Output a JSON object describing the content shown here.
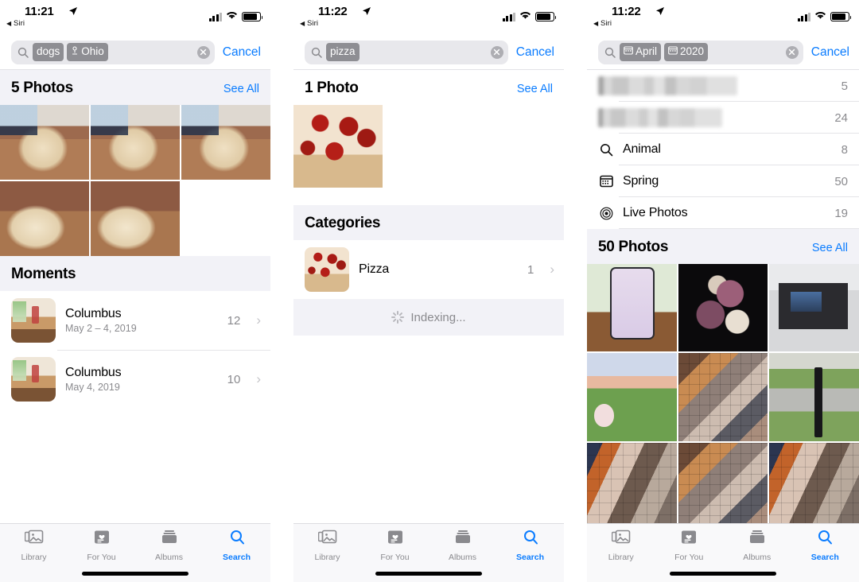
{
  "panels": [
    {
      "id": "panel-dogs-ohio",
      "status": {
        "time": "11:21",
        "back_label": "Siri",
        "location_icon": "location-arrow-icon",
        "signal_icon": "cellular-signal-icon",
        "wifi_icon": "wifi-icon",
        "battery_icon": "battery-icon"
      },
      "search": {
        "icon": "search-icon",
        "tokens": [
          {
            "label": "dogs",
            "icon": null
          },
          {
            "label": "Ohio",
            "icon": "location-pin-icon"
          }
        ],
        "clear_icon": "clear-x-icon",
        "cancel_label": "Cancel"
      },
      "photos_section": {
        "title": "5 Photos",
        "see_all": "See All",
        "count": 5
      },
      "moments": {
        "title": "Moments",
        "rows": [
          {
            "title": "Columbus",
            "subtitle": "May 2 – 4, 2019",
            "count": "12",
            "chevron": "chevron-right-icon"
          },
          {
            "title": "Columbus",
            "subtitle": "May 4, 2019",
            "count": "10",
            "chevron": "chevron-right-icon"
          }
        ]
      },
      "tabs": [
        {
          "label": "Library",
          "icon": "photos-library-icon",
          "active": false
        },
        {
          "label": "For You",
          "icon": "for-you-heart-icon",
          "active": false
        },
        {
          "label": "Albums",
          "icon": "albums-icon",
          "active": false
        },
        {
          "label": "Search",
          "icon": "search-icon",
          "active": true
        }
      ]
    },
    {
      "id": "panel-pizza",
      "status": {
        "time": "11:22",
        "back_label": "Siri",
        "location_icon": "location-arrow-icon",
        "signal_icon": "cellular-signal-icon",
        "wifi_icon": "wifi-icon",
        "battery_icon": "battery-icon"
      },
      "search": {
        "icon": "search-icon",
        "tokens": [
          {
            "label": "pizza",
            "icon": null
          }
        ],
        "clear_icon": "clear-x-icon",
        "cancel_label": "Cancel"
      },
      "photos_section": {
        "title": "1 Photo",
        "see_all": "See All",
        "count": 1
      },
      "categories": {
        "title": "Categories",
        "rows": [
          {
            "title": "Pizza",
            "count": "1",
            "chevron": "chevron-right-icon"
          }
        ]
      },
      "indexing": {
        "label": "Indexing...",
        "icon": "activity-spinner-icon"
      },
      "tabs": [
        {
          "label": "Library",
          "icon": "photos-library-icon",
          "active": false
        },
        {
          "label": "For You",
          "icon": "for-you-heart-icon",
          "active": false
        },
        {
          "label": "Albums",
          "icon": "albums-icon",
          "active": false
        },
        {
          "label": "Search",
          "icon": "search-icon",
          "active": true
        }
      ]
    },
    {
      "id": "panel-april-2020",
      "status": {
        "time": "11:22",
        "back_label": "Siri",
        "location_icon": "location-arrow-icon",
        "signal_icon": "cellular-signal-icon",
        "wifi_icon": "wifi-icon",
        "battery_icon": "battery-icon"
      },
      "search": {
        "icon": "search-icon",
        "tokens": [
          {
            "label": "April",
            "icon": "calendar-icon"
          },
          {
            "label": "2020",
            "icon": "calendar-icon"
          }
        ],
        "clear_icon": "clear-x-icon",
        "cancel_label": "Cancel"
      },
      "suggestion_rows": [
        {
          "label": "",
          "redacted": true,
          "count": "5",
          "icon": null
        },
        {
          "label": "",
          "redacted": true,
          "count": "24",
          "icon": null
        },
        {
          "label": "Animal",
          "redacted": false,
          "count": "8",
          "icon": "search-icon"
        },
        {
          "label": "Spring",
          "redacted": false,
          "count": "50",
          "icon": "calendar-icon"
        },
        {
          "label": "Live Photos",
          "redacted": false,
          "count": "19",
          "icon": "live-photo-icon"
        }
      ],
      "photos_section": {
        "title": "50 Photos",
        "see_all": "See All",
        "count": 50
      },
      "tabs": [
        {
          "label": "Library",
          "icon": "photos-library-icon",
          "active": false
        },
        {
          "label": "For You",
          "icon": "for-you-heart-icon",
          "active": false
        },
        {
          "label": "Albums",
          "icon": "albums-icon",
          "active": false
        },
        {
          "label": "Search",
          "icon": "search-icon",
          "active": true
        }
      ]
    }
  ],
  "colors": {
    "accent_blue": "#0a7cff",
    "token_gray": "#8e8e93",
    "section_bg": "#f2f2f7",
    "secondary_text": "#8a8a8e"
  }
}
